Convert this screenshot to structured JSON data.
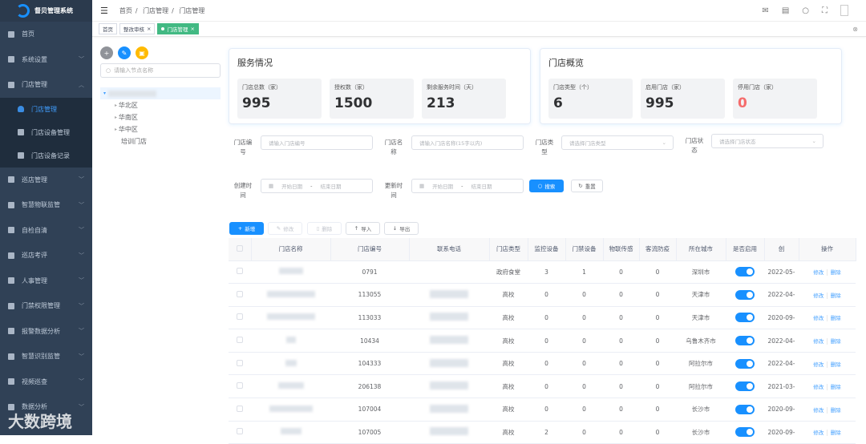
{
  "app": {
    "title": "督贝管理系统"
  },
  "sidebar": {
    "items": [
      {
        "label": "首页",
        "icon": "dashboard-icon"
      },
      {
        "label": "系统设置",
        "icon": "user-icon"
      },
      {
        "label": "门店管理",
        "icon": "store-icon",
        "expanded": true,
        "children": [
          {
            "label": "门店管理",
            "active": true
          },
          {
            "label": "门店设备管理"
          },
          {
            "label": "门店设备记录"
          }
        ]
      },
      {
        "label": "巡店管理",
        "icon": "grid-icon"
      },
      {
        "label": "智慧物联监管",
        "icon": "gear-icon"
      },
      {
        "label": "自检自清",
        "icon": "doc-icon"
      },
      {
        "label": "巡店考评",
        "icon": "doc-icon"
      },
      {
        "label": "人事管理",
        "icon": "people-icon"
      },
      {
        "label": "门禁权限管理",
        "icon": "door-icon"
      },
      {
        "label": "报警数据分析",
        "icon": "chart-icon"
      },
      {
        "label": "智慧识别监管",
        "icon": "gear-icon"
      },
      {
        "label": "视频巡查",
        "icon": "video-icon"
      },
      {
        "label": "数据分析",
        "icon": "chart-icon"
      }
    ]
  },
  "watermark": "大数跨境",
  "breadcrumb": [
    "首页",
    "门店管理",
    "门店管理"
  ],
  "breadcrumb_sep": "/",
  "tabs": [
    {
      "label": "首页"
    },
    {
      "label": "整改审核"
    },
    {
      "label": "门店管理",
      "active": true
    }
  ],
  "tab_close": "×",
  "tree": {
    "search_placeholder": "请输入节点名称",
    "nodes": [
      "华北区",
      "华南区",
      "华中区",
      "培训门店"
    ]
  },
  "service_card": {
    "title": "服务情况",
    "stats": [
      {
        "label": "门店总数（家）",
        "value": "995"
      },
      {
        "label": "授权数（家）",
        "value": "1500"
      },
      {
        "label": "剩余服务时间（天）",
        "value": "213"
      }
    ]
  },
  "overview_card": {
    "title": "门店概览",
    "stats": [
      {
        "label": "门店类型（个）",
        "value": "6"
      },
      {
        "label": "启用门店（家）",
        "value": "995"
      },
      {
        "label": "停用门店（家）",
        "value": "0"
      }
    ]
  },
  "filters": {
    "store_no": {
      "label": "门店编号",
      "placeholder": "请输入门店编号"
    },
    "store_name": {
      "label": "门店名称",
      "placeholder": "请输入门店名称(15字以内)"
    },
    "store_type": {
      "label": "门店类型",
      "placeholder": "请选择门店类型"
    },
    "store_status": {
      "label": "门店状态",
      "placeholder": "请选择门店状态"
    },
    "created": {
      "label": "创建时间",
      "start": "开始日期",
      "end": "结束日期"
    },
    "updated": {
      "label": "更新时间",
      "start": "开始日期",
      "end": "结束日期"
    },
    "range_sep": "-",
    "search": "搜索",
    "reset": "重置"
  },
  "toolbar": {
    "add": "新增",
    "edit": "修改",
    "delete": "删除",
    "import": "导入",
    "export": "导出"
  },
  "table": {
    "headers": [
      "门店名称",
      "门店编号",
      "联系电话",
      "门店类型",
      "监控设备",
      "门禁设备",
      "物联传感",
      "客流防疫",
      "所在城市",
      "是否启用",
      "创",
      "操作"
    ],
    "rows": [
      {
        "no": "0791",
        "type": "政府食堂",
        "cam": "3",
        "door": "1",
        "iot": "0",
        "flow": "0",
        "city": "深圳市",
        "enabled": true,
        "created": "2022-05-"
      },
      {
        "no": "113055",
        "type": "高校",
        "cam": "0",
        "door": "0",
        "iot": "0",
        "flow": "0",
        "city": "天津市",
        "enabled": true,
        "created": "2022-04-"
      },
      {
        "no": "113033",
        "type": "高校",
        "cam": "0",
        "door": "0",
        "iot": "0",
        "flow": "0",
        "city": "天津市",
        "enabled": true,
        "created": "2020-09-"
      },
      {
        "no": "10434",
        "type": "高校",
        "cam": "0",
        "door": "0",
        "iot": "0",
        "flow": "0",
        "city": "乌鲁木齐市",
        "enabled": true,
        "created": "2022-04-"
      },
      {
        "no": "104333",
        "type": "高校",
        "cam": "0",
        "door": "0",
        "iot": "0",
        "flow": "0",
        "city": "阿拉尔市",
        "enabled": true,
        "created": "2022-04-"
      },
      {
        "no": "206138",
        "type": "高校",
        "cam": "0",
        "door": "0",
        "iot": "0",
        "flow": "0",
        "city": "阿拉尔市",
        "enabled": true,
        "created": "2021-03-"
      },
      {
        "no": "107004",
        "type": "高校",
        "cam": "0",
        "door": "0",
        "iot": "0",
        "flow": "0",
        "city": "长沙市",
        "enabled": true,
        "created": "2020-09-"
      },
      {
        "no": "107005",
        "type": "高校",
        "cam": "2",
        "door": "0",
        "iot": "0",
        "flow": "0",
        "city": "长沙市",
        "enabled": true,
        "created": "2020-09-"
      }
    ],
    "row_actions": {
      "edit": "修改",
      "delete": "删除"
    }
  },
  "colors": {
    "sidebar": "#304156",
    "primary": "#1890ff",
    "tab_active": "#42b983",
    "danger": "#f56c6c"
  }
}
